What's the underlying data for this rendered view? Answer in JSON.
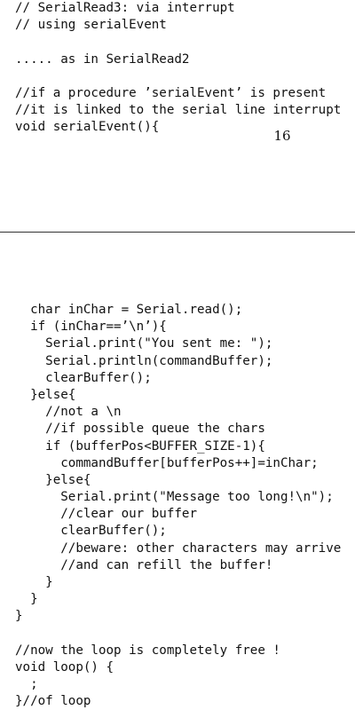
{
  "top_code": {
    "lines": [
      "// SerialRead3: via interrupt",
      "// using serialEvent",
      "",
      "..... as in SerialRead2",
      "",
      "//if a procedure ’serialEvent’ is present",
      "//it is linked to the serial line interrupt",
      "void serialEvent(){"
    ]
  },
  "page_number": "16",
  "bottom_code": {
    "lines": [
      "  char inChar = Serial.read();",
      "  if (inChar==’\\n’){",
      "    Serial.print(\"You sent me: \");",
      "    Serial.println(commandBuffer);",
      "    clearBuffer();",
      "  }else{",
      "    //not a \\n",
      "    //if possible queue the chars",
      "    if (bufferPos<BUFFER_SIZE-1){",
      "      commandBuffer[bufferPos++]=inChar;",
      "    }else{",
      "      Serial.print(\"Message too long!\\n\");",
      "      //clear our buffer",
      "      clearBuffer();",
      "      //beware: other characters may arrive",
      "      //and can refill the buffer!",
      "    }",
      "  }",
      "}",
      "",
      "//now the loop is completely free !",
      "void loop() {",
      "  ;",
      "}//of loop"
    ]
  }
}
